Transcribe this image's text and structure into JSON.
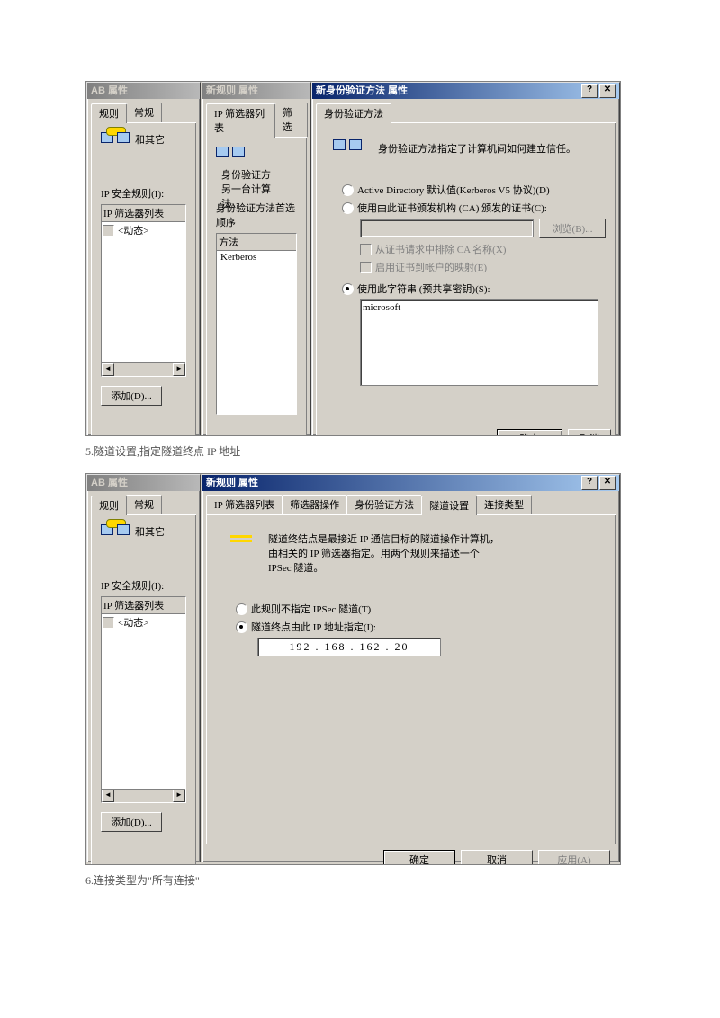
{
  "shot1": {
    "winA": {
      "title": "AB 属性",
      "tabs": [
        "规则",
        "常规"
      ],
      "desc": "和其它",
      "rules_label": "IP 安全规则(I):",
      "col": "IP 筛选器列表",
      "item": "<动态>",
      "add": "添加(D)..."
    },
    "winB": {
      "title": "新规则 属性",
      "tabs": [
        "IP 筛选器列表",
        "筛选"
      ],
      "desc": "身份验证方\n另一台计算\n法。",
      "sect": "身份验证方法首选顺序",
      "col": "方法",
      "item": "Kerberos"
    },
    "winC": {
      "title": "新身份验证方法 属性",
      "tab": "身份验证方法",
      "desc": "身份验证方法指定了计算机间如何建立信任。",
      "r1": "Active Directory 默认值(Kerberos V5 协议)(D)",
      "r2": "使用由此证书颁发机构 (CA) 颁发的证书(C):",
      "browse": "浏览(B)...",
      "c1": "从证书请求中排除 CA 名称(X)",
      "c2": "启用证书到帐户的映射(E)",
      "r3": "使用此字符串 (预共享密钥)(S):",
      "key": "microsoft",
      "ok": "确定",
      "cancel": "取消"
    }
  },
  "cap1": "5.隧道设置,指定隧道终点 IP 地址",
  "shot2": {
    "winA": {
      "title": "AB 属性",
      "tabs": [
        "规则",
        "常规"
      ],
      "desc": "和其它",
      "rules_label": "IP 安全规则(I):",
      "col": "IP 筛选器列表",
      "item": "<动态>",
      "add": "添加(D)..."
    },
    "winB": {
      "title": "新规则 属性",
      "tabs": [
        "IP 筛选器列表",
        "筛选器操作",
        "身份验证方法",
        "隧道设置",
        "连接类型"
      ],
      "desc": "隧道终结点是最接近 IP 通信目标的隧道操作计算机，\n由相关的 IP 筛选器指定。用两个规则来描述一个\nIPSec 隧道。",
      "r1": "此规则不指定 IPSec 隧道(T)",
      "r2": "隧道终点由此 IP 地址指定(I):",
      "ip": "192 . 168 . 162 .  20",
      "ok": "确定",
      "cancel": "取消",
      "apply": "应用(A)"
    }
  },
  "cap2": "6.连接类型为\"所有连接\""
}
